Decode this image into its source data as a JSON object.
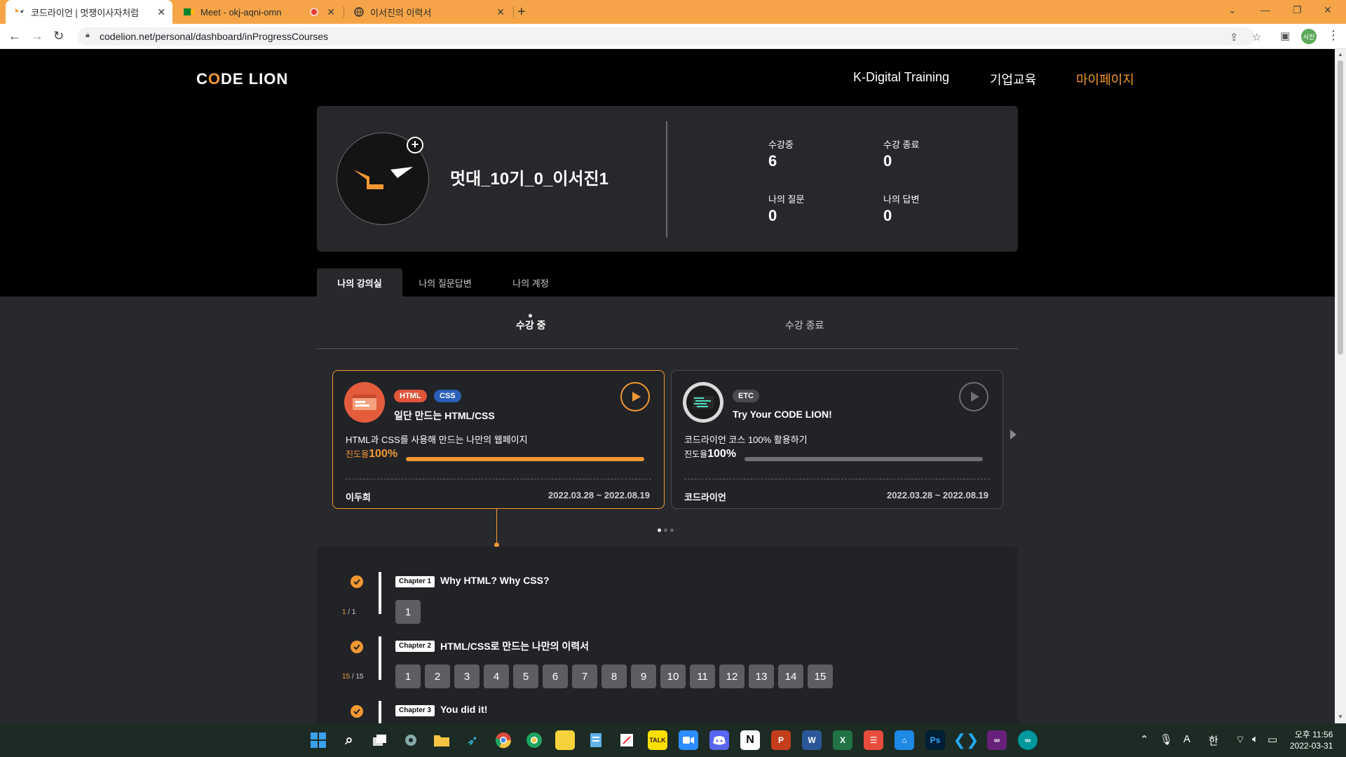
{
  "browser": {
    "tabs": [
      {
        "title": "코드라이언 | 멋쟁이사자처럼",
        "active": true
      },
      {
        "title": "Meet - okj-aqni-omn",
        "active": false
      },
      {
        "title": "이서진의 이력서",
        "active": false
      }
    ],
    "url": "codelion.net/personal/dashboard/inProgressCourses",
    "profile_initials": "서진"
  },
  "header": {
    "logo": {
      "part1": "C",
      "part2": "DE LION"
    },
    "nav": [
      "K-Digital Training",
      "기업교육",
      "마이페이지"
    ]
  },
  "profile": {
    "username": "멋대_10기_0_이서진1",
    "stats": {
      "in_progress_label": "수강중",
      "in_progress": "6",
      "completed_label": "수강 종료",
      "completed": "0",
      "questions_label": "나의 질문",
      "questions": "0",
      "answers_label": "나의 답변",
      "answers": "0"
    }
  },
  "page_tabs": [
    "나의 강의실",
    "나의 질문답변",
    "나의 계정"
  ],
  "sub_tabs": [
    "수강 중",
    "수강 종료"
  ],
  "courses": [
    {
      "badges": [
        "HTML",
        "CSS"
      ],
      "title": "일단 만드는 HTML/CSS",
      "description": "HTML과 CSS를 사용해 만드는 나만의 웹페이지",
      "progress_label": "진도율",
      "progress": "100%",
      "progress_value": 1.0,
      "instructor": "이두희",
      "dates": "2022.03.28 ~ 2022.08.19",
      "accent": "#f29833"
    },
    {
      "badges": [
        "ETC"
      ],
      "title": "Try Your CODE LION!",
      "description": "코드라이언 코스 100% 활용하기",
      "progress_label": "진도율",
      "progress": "100%",
      "progress_value": 1.0,
      "instructor": "코드라이언",
      "dates": "2022.03.28 ~ 2022.08.19",
      "accent": "#6e6f73"
    }
  ],
  "chapters": [
    {
      "chip": "Chapter 1",
      "title": "Why HTML? Why CSS?",
      "done": "1",
      "total": "1",
      "lessons": [
        "1"
      ]
    },
    {
      "chip": "Chapter 2",
      "title": "HTML/CSS로 만드는 나만의 이력서",
      "done": "15",
      "total": "15",
      "lessons": [
        "1",
        "2",
        "3",
        "4",
        "5",
        "6",
        "7",
        "8",
        "9",
        "10",
        "11",
        "12",
        "13",
        "14",
        "15"
      ]
    },
    {
      "chip": "Chapter 3",
      "title": "You did it!",
      "done": "",
      "total": "",
      "lessons": []
    }
  ],
  "taskbar": {
    "lang_indicator": "A",
    "ime": "한",
    "time": "오후 11:56",
    "date": "2022-03-31"
  },
  "colors": {
    "accent": "#f29833",
    "html_badge": "#e0553a",
    "css_badge": "#2b5fb8",
    "etc_badge": "#4a4b4f",
    "chrome": "#f5a547"
  }
}
